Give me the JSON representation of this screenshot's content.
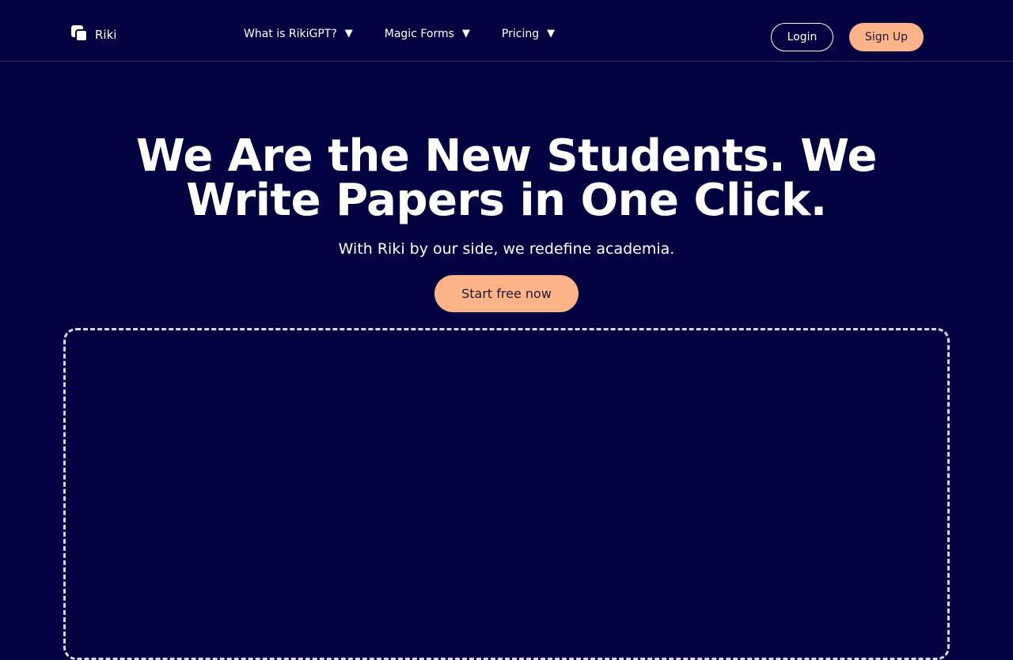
{
  "header": {
    "brand": "Riki",
    "brand_icon": "riki-logo-icon",
    "nav": [
      {
        "label": "What is RikiGPT?",
        "icon": "caret-down-icon"
      },
      {
        "label": "Magic Forms",
        "icon": "caret-down-icon"
      },
      {
        "label": "Pricing",
        "icon": "caret-down-icon"
      }
    ],
    "login_label": "Login",
    "signup_label": "Sign Up"
  },
  "hero": {
    "title": "We Are the New Students. We Write Papers in One Click.",
    "subtitle": "With Riki by our side, we redefine academia.",
    "cta_label": "Start free now"
  },
  "colors": {
    "background": "#020241",
    "accent": "#ffb488",
    "text": "#ffffff"
  }
}
